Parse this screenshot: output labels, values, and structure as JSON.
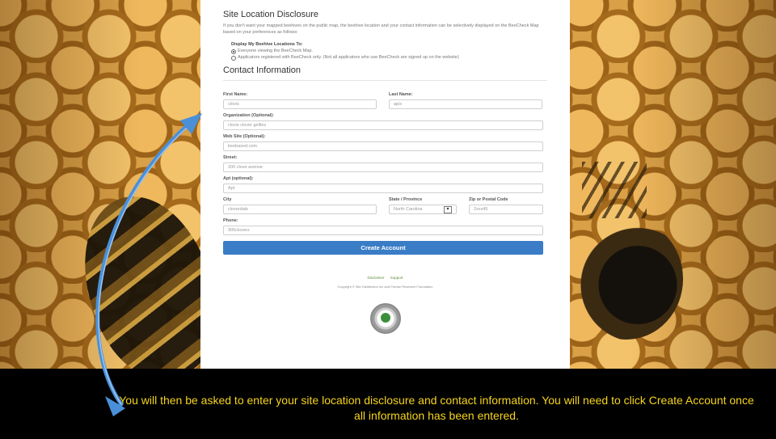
{
  "disclosure": {
    "title": "Site Location Disclosure",
    "intro": "If you don't want your mapped beehives on the public map, the beehive location and your contact information can be selectively displayed on the BeeCheck Map based on your preferences as follows:",
    "display_heading": "Display My Beehive Locations To:",
    "option_1": "Everyone viewing the BeeCheck Map.",
    "option_2": "Applicators registered with BeeCheck only. (Not all applicators who use BeeCheck are signed up on the website)",
    "selected": 1
  },
  "contact": {
    "title": "Contact Information",
    "first_name_label": "First Name:",
    "first_name_value": "clovis",
    "last_name_label": "Last Name:",
    "last_name_value": "apis",
    "org_label": "Organization (Optional):",
    "org_value": "clovis clover gellies",
    "website_label": "Web Site (Optional):",
    "website_value": "beebased.com",
    "street_label": "Street:",
    "street_value": "200 clove avenue",
    "apt_label": "Apt (optional):",
    "apt_placeholder": "Apt",
    "city_label": "City",
    "city_value": "cloverdale",
    "state_label": "State / Province",
    "state_value": "North Carolina",
    "zip_label": "Zip or Postal Code",
    "zip_value": "2xxx45",
    "phone_label": "Phone:",
    "phone_value": "905clovers",
    "create_button": "Create Account"
  },
  "footer": {
    "link_1": "Disclaimer",
    "link_2": "Support",
    "copyright": "Copyright © Site Distribution Inc and Purdue Research Foundation"
  },
  "caption": {
    "text": "You will then be asked to enter your site location disclosure and contact information.  You will need to click Create Account once all information has been entered."
  },
  "colors": {
    "caption_text": "#f5d41c",
    "button": "#3a7dc6",
    "arrow": "#4a90d9"
  }
}
